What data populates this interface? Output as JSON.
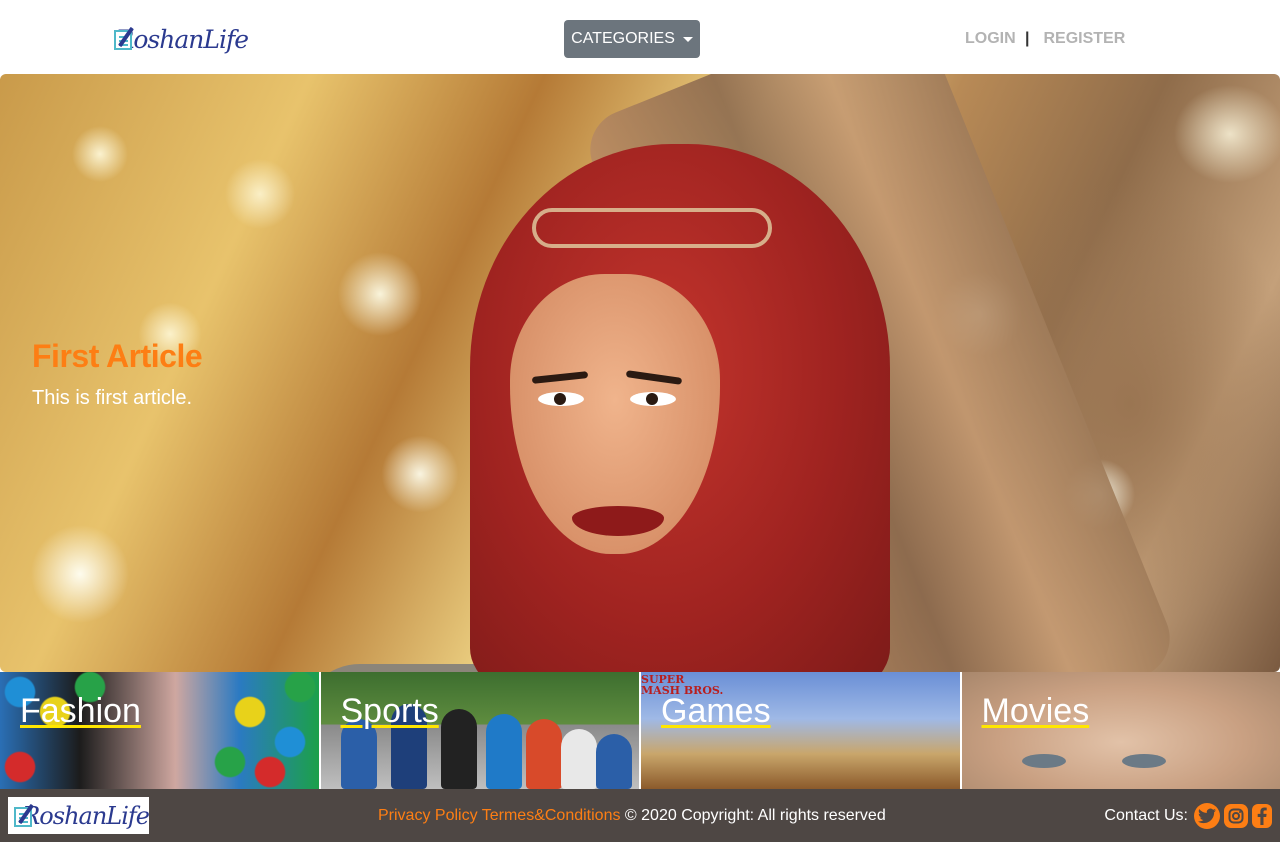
{
  "header": {
    "logo_text": "RoshanLife",
    "categories_label": "CATEGORIES",
    "login_label": "LOGIN",
    "separator": "|",
    "register_label": "REGISTER"
  },
  "hero": {
    "title": "First Article",
    "subtitle": "This is first article."
  },
  "categories": [
    {
      "label": "Fashion"
    },
    {
      "label": "Sports"
    },
    {
      "label": "Games"
    },
    {
      "label": "Movies"
    }
  ],
  "games_tile": {
    "logo_text_1": "SUPER",
    "logo_text_2": "MASH BROS."
  },
  "footer": {
    "logo_text": "RoshanLife",
    "privacy_label": "Privacy Policy",
    "terms_label": "Termes&Conditions",
    "copyright": "© 2020 Copyright: All rights reserved",
    "contact_label": "Contact Us:"
  },
  "colors": {
    "accent": "#fd7e14",
    "button": "#6c757d",
    "footer_bg": "#4e4744",
    "underline": "#ffe600"
  },
  "icons": [
    "twitter-icon",
    "instagram-icon",
    "facebook-icon",
    "caret-down-icon"
  ]
}
